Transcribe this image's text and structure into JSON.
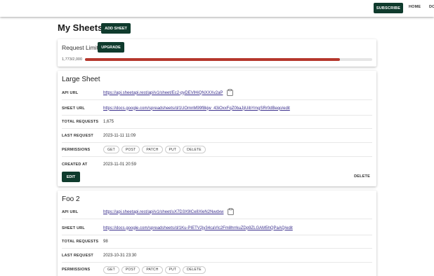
{
  "nav": {
    "subscribe": "SUBSCRIBE",
    "home": "HOME",
    "docs": "DO"
  },
  "header": {
    "title": "My Sheets",
    "add_sheet": "ADD SHEET"
  },
  "request_limit": {
    "title": "Request Limit",
    "upgrade": "UPGRADE",
    "count": "1,773/2,000",
    "used": 1773,
    "total": 2000
  },
  "labels": {
    "api_url": "API URL",
    "sheet_url": "SHEET URL",
    "total_requests": "TOTAL REQUESTS",
    "last_request": "LAST REQUEST",
    "permissions": "PERMISSIONS",
    "created_at": "CREATED AT",
    "edit": "EDIT",
    "delete": "DELETE"
  },
  "permissions": [
    "GET",
    "POST",
    "PATCH",
    "PUT",
    "DELETE"
  ],
  "sheets": [
    {
      "name": "Large Sheet",
      "api_url": "https://api.sheetapi.rest/api/v1/sheet/Ec2-pyDEVlHiQNXXXv2aP",
      "sheet_url": "https://docs.google.com/spreadsheets/d/1UOmnM99f8kjw_43iOxxFqZ0baJjiUibYmgSRr0dBeqo/edit",
      "total_requests": "1,675",
      "last_request": "2023-11-11 11:09",
      "created_at": "2023-11-01 20:59"
    },
    {
      "name": "Foo 2",
      "api_url": "https://api.sheetapi.rest/api/v1/sheet/uX7D3X9lCe8XleN2Nwdxw",
      "sheet_url": "https://docs.google.com/spreadsheets/d/1Ku-PIETV2jy34caVlc2Fm8hrrkuZDp9ZLGAM5hQPaAQ/edit",
      "total_requests": "98",
      "last_request": "2023-10-31 23:30"
    }
  ],
  "colors": {
    "primary": "#0f3b2d",
    "progress": "#b5372d",
    "link": "#3a2e8c"
  }
}
